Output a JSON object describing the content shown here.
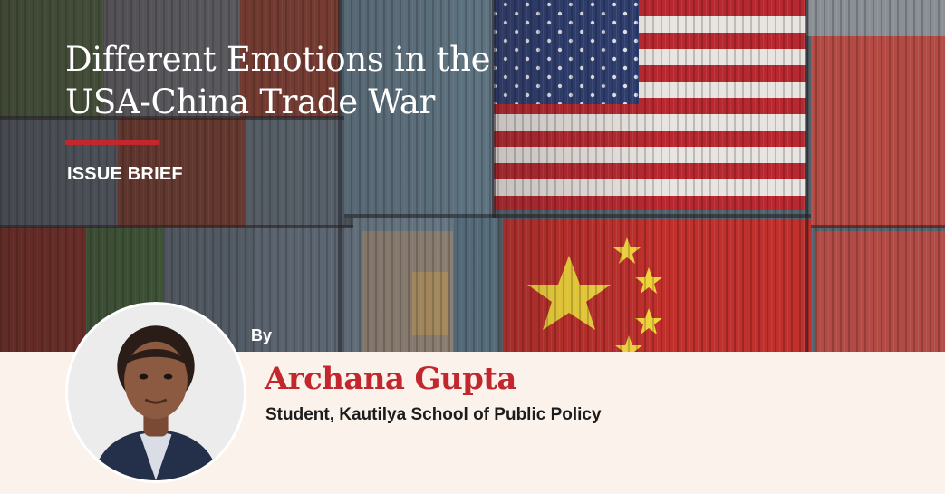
{
  "brief": {
    "title_line1": "Different Emotions in the",
    "title_line2": "USA-China Trade War",
    "kicker": "ISSUE BRIEF"
  },
  "author": {
    "by_label": "By",
    "name": "Archana Gupta",
    "affiliation": "Student, Kautilya School of Public Policy"
  },
  "colors": {
    "accent_red": "#c1272d",
    "footer_bg": "#fbf2ec",
    "title_text": "#ffffff",
    "body_text": "#1c1c1c"
  }
}
